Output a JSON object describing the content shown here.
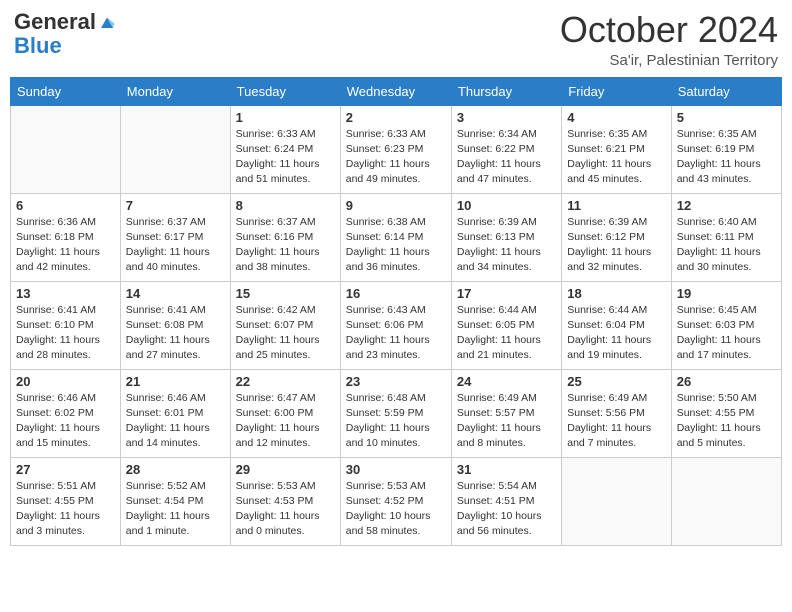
{
  "header": {
    "logo_general": "General",
    "logo_blue": "Blue",
    "main_title": "October 2024",
    "sub_title": "Sa'ir, Palestinian Territory"
  },
  "days_of_week": [
    "Sunday",
    "Monday",
    "Tuesday",
    "Wednesday",
    "Thursday",
    "Friday",
    "Saturday"
  ],
  "weeks": [
    [
      {
        "day": "",
        "info": ""
      },
      {
        "day": "",
        "info": ""
      },
      {
        "day": "1",
        "info": "Sunrise: 6:33 AM\nSunset: 6:24 PM\nDaylight: 11 hours and 51 minutes."
      },
      {
        "day": "2",
        "info": "Sunrise: 6:33 AM\nSunset: 6:23 PM\nDaylight: 11 hours and 49 minutes."
      },
      {
        "day": "3",
        "info": "Sunrise: 6:34 AM\nSunset: 6:22 PM\nDaylight: 11 hours and 47 minutes."
      },
      {
        "day": "4",
        "info": "Sunrise: 6:35 AM\nSunset: 6:21 PM\nDaylight: 11 hours and 45 minutes."
      },
      {
        "day": "5",
        "info": "Sunrise: 6:35 AM\nSunset: 6:19 PM\nDaylight: 11 hours and 43 minutes."
      }
    ],
    [
      {
        "day": "6",
        "info": "Sunrise: 6:36 AM\nSunset: 6:18 PM\nDaylight: 11 hours and 42 minutes."
      },
      {
        "day": "7",
        "info": "Sunrise: 6:37 AM\nSunset: 6:17 PM\nDaylight: 11 hours and 40 minutes."
      },
      {
        "day": "8",
        "info": "Sunrise: 6:37 AM\nSunset: 6:16 PM\nDaylight: 11 hours and 38 minutes."
      },
      {
        "day": "9",
        "info": "Sunrise: 6:38 AM\nSunset: 6:14 PM\nDaylight: 11 hours and 36 minutes."
      },
      {
        "day": "10",
        "info": "Sunrise: 6:39 AM\nSunset: 6:13 PM\nDaylight: 11 hours and 34 minutes."
      },
      {
        "day": "11",
        "info": "Sunrise: 6:39 AM\nSunset: 6:12 PM\nDaylight: 11 hours and 32 minutes."
      },
      {
        "day": "12",
        "info": "Sunrise: 6:40 AM\nSunset: 6:11 PM\nDaylight: 11 hours and 30 minutes."
      }
    ],
    [
      {
        "day": "13",
        "info": "Sunrise: 6:41 AM\nSunset: 6:10 PM\nDaylight: 11 hours and 28 minutes."
      },
      {
        "day": "14",
        "info": "Sunrise: 6:41 AM\nSunset: 6:08 PM\nDaylight: 11 hours and 27 minutes."
      },
      {
        "day": "15",
        "info": "Sunrise: 6:42 AM\nSunset: 6:07 PM\nDaylight: 11 hours and 25 minutes."
      },
      {
        "day": "16",
        "info": "Sunrise: 6:43 AM\nSunset: 6:06 PM\nDaylight: 11 hours and 23 minutes."
      },
      {
        "day": "17",
        "info": "Sunrise: 6:44 AM\nSunset: 6:05 PM\nDaylight: 11 hours and 21 minutes."
      },
      {
        "day": "18",
        "info": "Sunrise: 6:44 AM\nSunset: 6:04 PM\nDaylight: 11 hours and 19 minutes."
      },
      {
        "day": "19",
        "info": "Sunrise: 6:45 AM\nSunset: 6:03 PM\nDaylight: 11 hours and 17 minutes."
      }
    ],
    [
      {
        "day": "20",
        "info": "Sunrise: 6:46 AM\nSunset: 6:02 PM\nDaylight: 11 hours and 15 minutes."
      },
      {
        "day": "21",
        "info": "Sunrise: 6:46 AM\nSunset: 6:01 PM\nDaylight: 11 hours and 14 minutes."
      },
      {
        "day": "22",
        "info": "Sunrise: 6:47 AM\nSunset: 6:00 PM\nDaylight: 11 hours and 12 minutes."
      },
      {
        "day": "23",
        "info": "Sunrise: 6:48 AM\nSunset: 5:59 PM\nDaylight: 11 hours and 10 minutes."
      },
      {
        "day": "24",
        "info": "Sunrise: 6:49 AM\nSunset: 5:57 PM\nDaylight: 11 hours and 8 minutes."
      },
      {
        "day": "25",
        "info": "Sunrise: 6:49 AM\nSunset: 5:56 PM\nDaylight: 11 hours and 7 minutes."
      },
      {
        "day": "26",
        "info": "Sunrise: 5:50 AM\nSunset: 4:55 PM\nDaylight: 11 hours and 5 minutes."
      }
    ],
    [
      {
        "day": "27",
        "info": "Sunrise: 5:51 AM\nSunset: 4:55 PM\nDaylight: 11 hours and 3 minutes."
      },
      {
        "day": "28",
        "info": "Sunrise: 5:52 AM\nSunset: 4:54 PM\nDaylight: 11 hours and 1 minute."
      },
      {
        "day": "29",
        "info": "Sunrise: 5:53 AM\nSunset: 4:53 PM\nDaylight: 11 hours and 0 minutes."
      },
      {
        "day": "30",
        "info": "Sunrise: 5:53 AM\nSunset: 4:52 PM\nDaylight: 10 hours and 58 minutes."
      },
      {
        "day": "31",
        "info": "Sunrise: 5:54 AM\nSunset: 4:51 PM\nDaylight: 10 hours and 56 minutes."
      },
      {
        "day": "",
        "info": ""
      },
      {
        "day": "",
        "info": ""
      }
    ]
  ]
}
